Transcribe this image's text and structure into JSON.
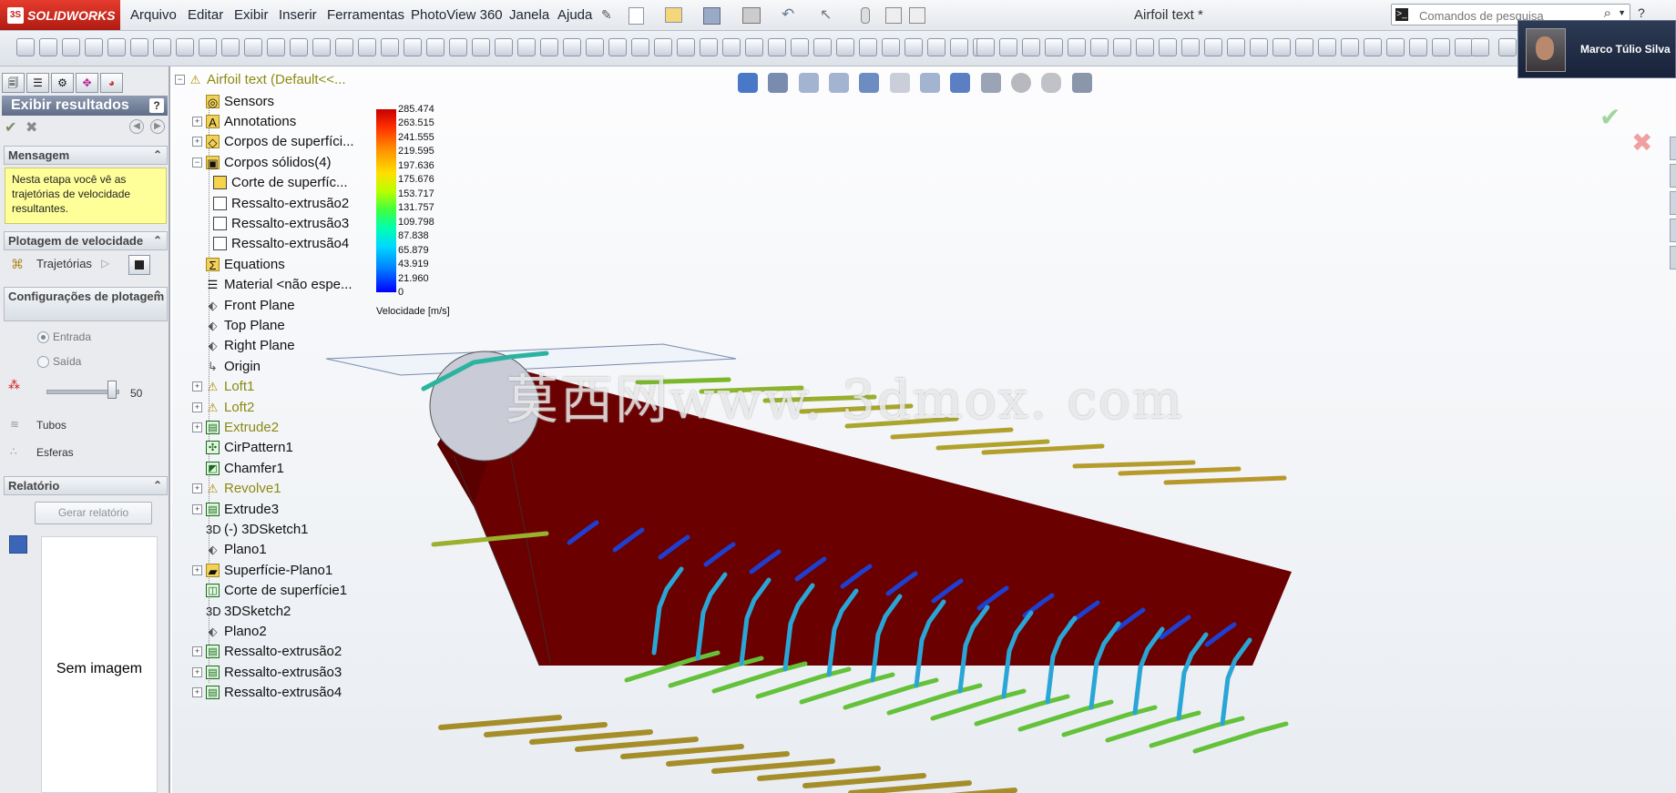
{
  "app": {
    "brand": "SOLIDWORKS",
    "window_title": "Airfoil text *",
    "menu": [
      "Arquivo",
      "Editar",
      "Exibir",
      "Inserir",
      "Ferramentas",
      "PhotoView 360",
      "Janela",
      "Ajuda"
    ],
    "search_placeholder": "Comandos de pesquisa",
    "user_name": "Marco Túlio Silva"
  },
  "panel": {
    "title": "Exibir resultados",
    "help": "?",
    "sections": {
      "mensagem": {
        "title": "Mensagem",
        "text": "Nesta etapa você vê as trajetórias de velocidade resultantes."
      },
      "plotagem": {
        "title": "Plotagem de velocidade",
        "trajetorias": "Trajetórias"
      },
      "config": {
        "title": "Configurações de plotagem",
        "entrada": "Entrada",
        "saida": "Saída",
        "slider_value": "50",
        "tubos": "Tubos",
        "esferas": "Esferas"
      },
      "relatorio": {
        "title": "Relatório",
        "gerar": "Gerar relatório",
        "sem_imagem": "Sem imagem"
      }
    }
  },
  "tree": {
    "root": "Airfoil text  (Default<<...",
    "items": [
      {
        "label": "Sensors",
        "icon": "sensor-icon"
      },
      {
        "label": "Annotations",
        "icon": "annotations-icon"
      },
      {
        "label": "Corpos de superfíci...",
        "icon": "surface-bodies-icon"
      },
      {
        "label": "Corpos sólidos(4)",
        "icon": "solid-bodies-icon"
      },
      {
        "label": "Corte de superfíc...",
        "icon": "body-icon"
      },
      {
        "label": "Ressalto-extrusão2",
        "icon": "body-icon"
      },
      {
        "label": "Ressalto-extrusão3",
        "icon": "body-icon"
      },
      {
        "label": "Ressalto-extrusão4",
        "icon": "body-icon"
      },
      {
        "label": "Equations",
        "icon": "equations-icon"
      },
      {
        "label": "Material <não espe...",
        "icon": "material-icon"
      },
      {
        "label": "Front Plane",
        "icon": "plane-icon"
      },
      {
        "label": "Top Plane",
        "icon": "plane-icon"
      },
      {
        "label": "Right Plane",
        "icon": "plane-icon"
      },
      {
        "label": "Origin",
        "icon": "origin-icon"
      },
      {
        "label": "Loft1",
        "icon": "warning-icon"
      },
      {
        "label": "Loft2",
        "icon": "warning-icon"
      },
      {
        "label": "Extrude2",
        "icon": "extrude-icon"
      },
      {
        "label": "CirPattern1",
        "icon": "pattern-icon"
      },
      {
        "label": "Chamfer1",
        "icon": "chamfer-icon"
      },
      {
        "label": "Revolve1",
        "icon": "warning-icon"
      },
      {
        "label": "Extrude3",
        "icon": "extrude-icon"
      },
      {
        "label": "(-) 3DSketch1",
        "icon": "sketch3d-icon"
      },
      {
        "label": "Plano1",
        "icon": "plane-icon"
      },
      {
        "label": "Superfície-Plano1",
        "icon": "surface-plane-icon"
      },
      {
        "label": "Corte de superfície1",
        "icon": "surface-cut-icon"
      },
      {
        "label": "3DSketch2",
        "icon": "sketch3d-icon"
      },
      {
        "label": "Plano2",
        "icon": "plane-icon"
      },
      {
        "label": "Ressalto-extrusão2",
        "icon": "extrude-icon"
      },
      {
        "label": "Ressalto-extrusão3",
        "icon": "extrude-icon"
      },
      {
        "label": "Ressalto-extrusão4",
        "icon": "extrude-icon"
      }
    ]
  },
  "legend": {
    "ticks": [
      "285.474",
      "263.515",
      "241.555",
      "219.595",
      "197.636",
      "175.676",
      "153.717",
      "131.757",
      "109.798",
      "87.838",
      "65.879",
      "43.919",
      "21.960",
      "0"
    ],
    "title": "Velocidade [m/s]"
  },
  "watermark": "莫西网www. 3dmox. com",
  "colors": {
    "body": "#6b0000",
    "accent_menu": "#c4241a"
  }
}
